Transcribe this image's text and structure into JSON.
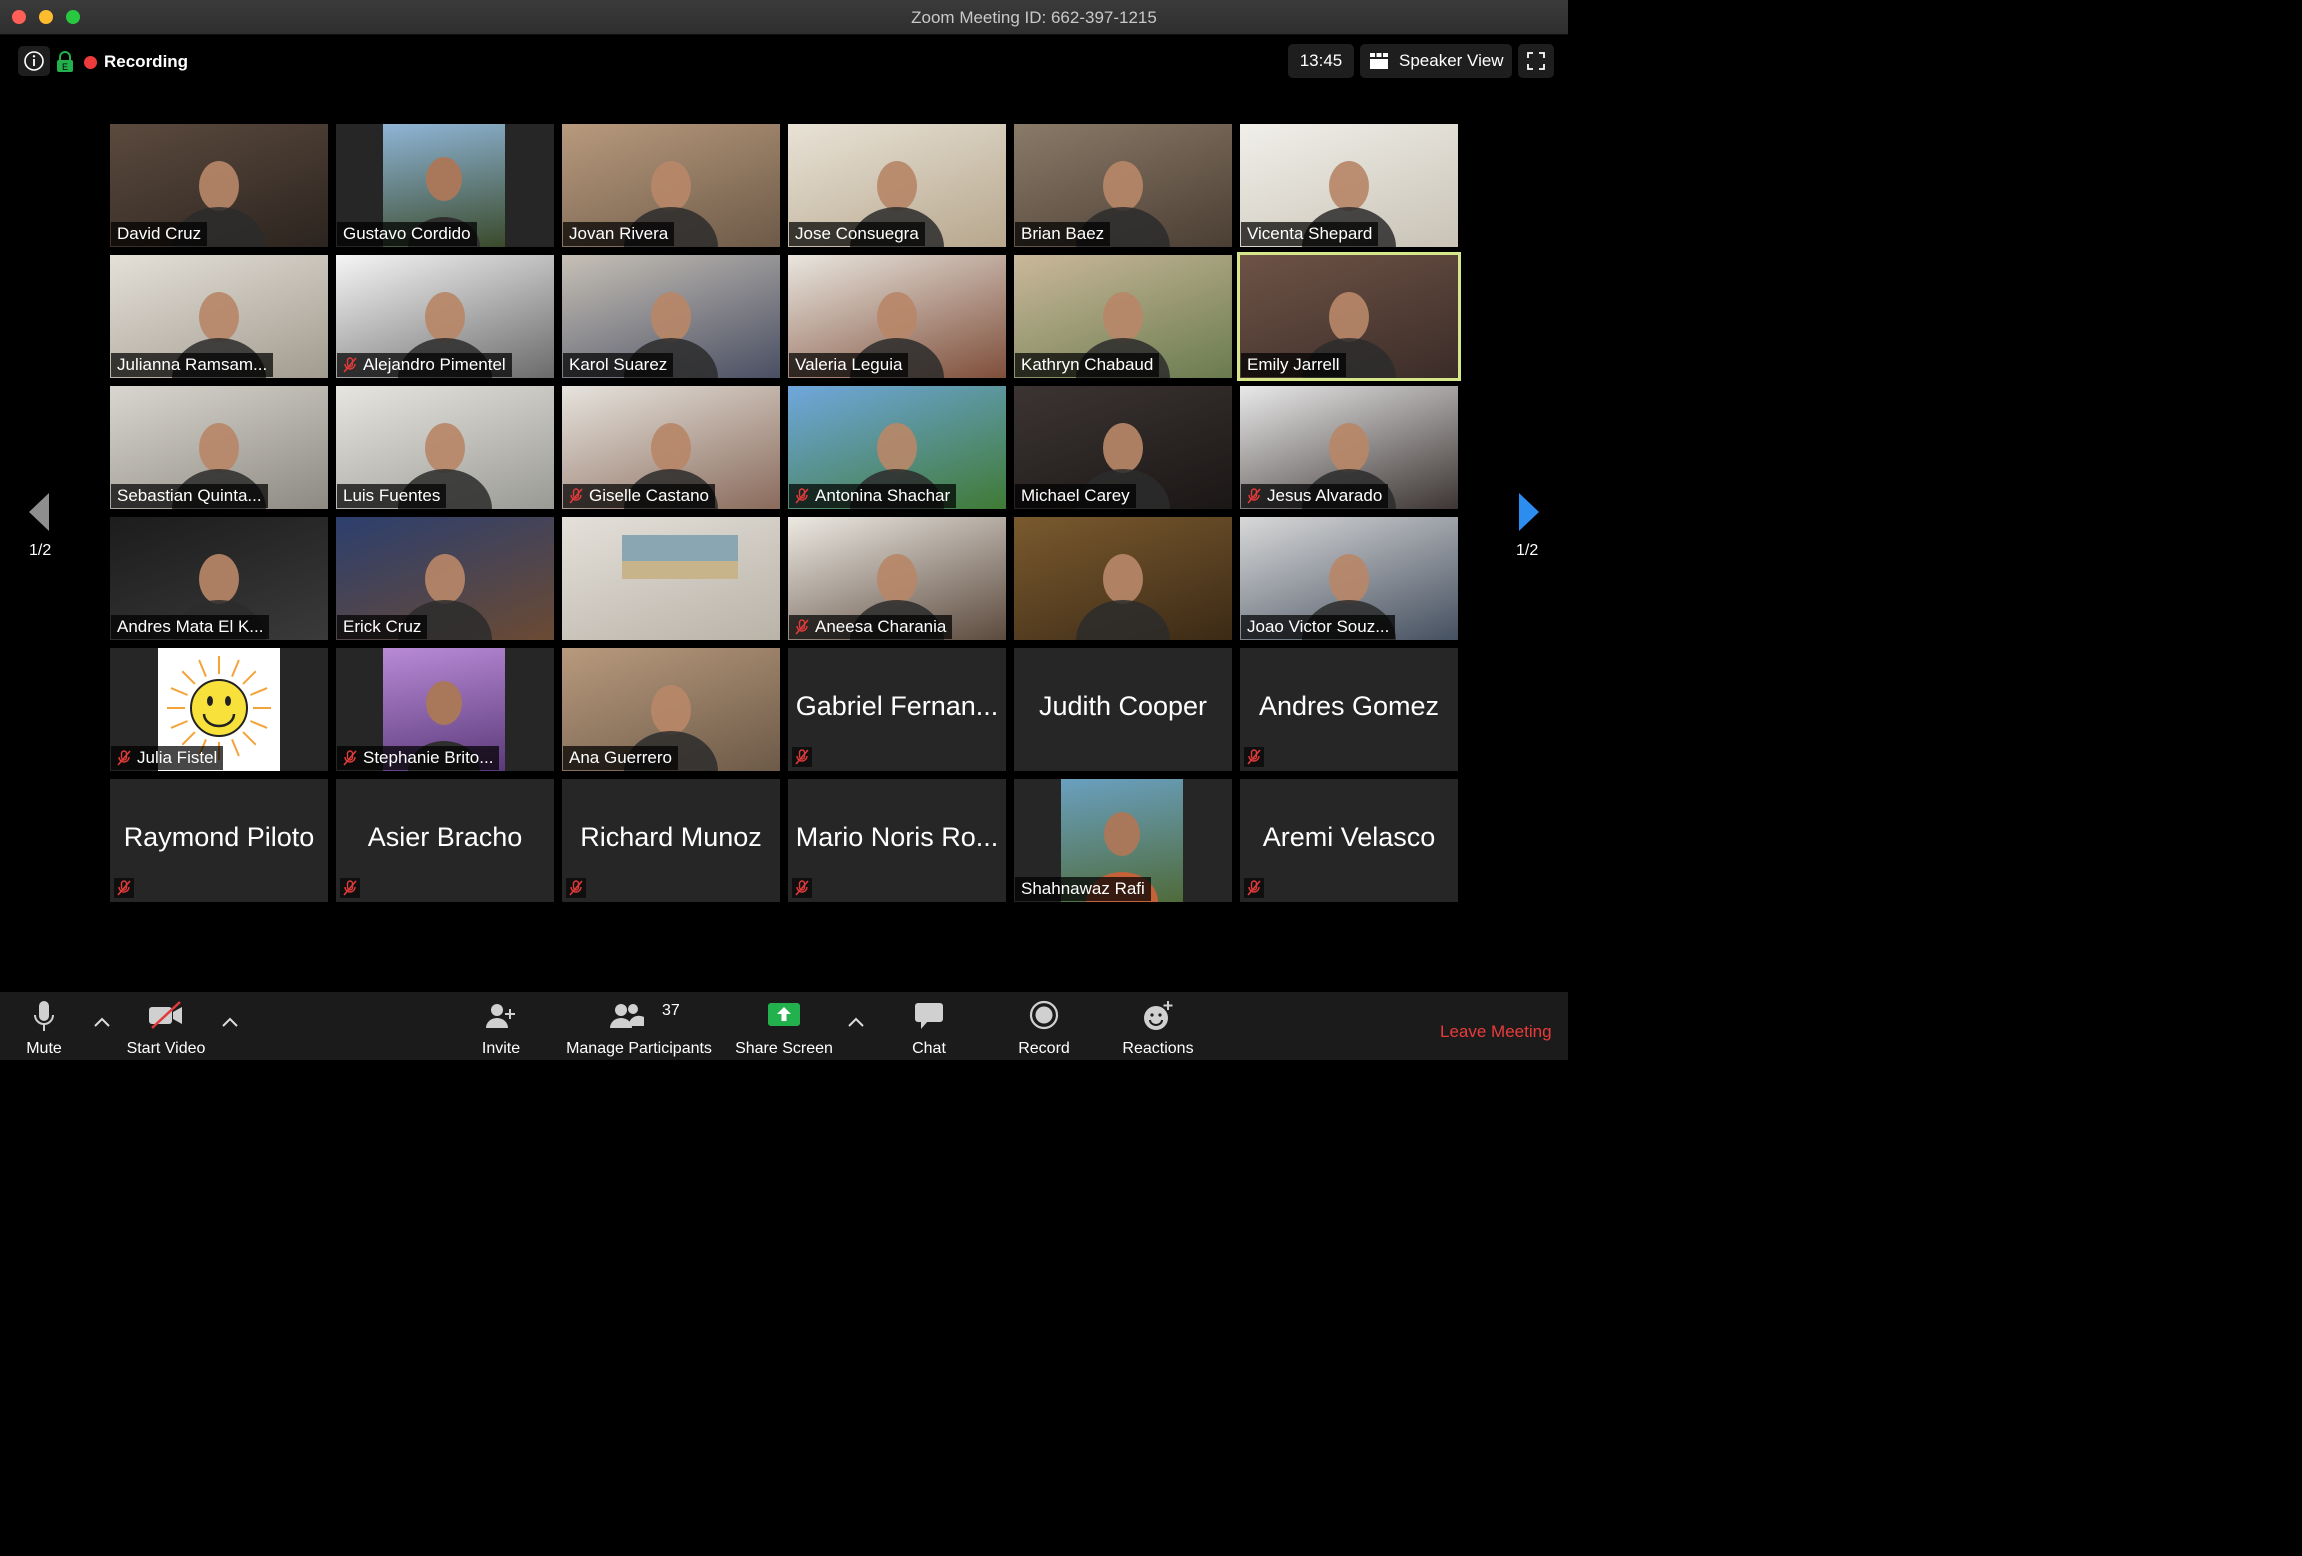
{
  "window": {
    "title": "Zoom Meeting ID: 662-397-1215"
  },
  "topbar": {
    "recording_label": "Recording",
    "time": "13:45",
    "speaker_view_label": "Speaker View"
  },
  "pagination": {
    "left": "1/2",
    "right": "1/2"
  },
  "participants": [
    {
      "name": "David Cruz",
      "muted": false,
      "video": true
    },
    {
      "name": "Gustavo Cordido",
      "muted": false,
      "video": true
    },
    {
      "name": "Jovan Rivera",
      "muted": false,
      "video": true
    },
    {
      "name": "Jose Consuegra",
      "muted": false,
      "video": true
    },
    {
      "name": "Brian Baez",
      "muted": false,
      "video": true
    },
    {
      "name": "Vicenta Shepard",
      "muted": false,
      "video": true
    },
    {
      "name": "Julianna Ramsam...",
      "muted": false,
      "video": true
    },
    {
      "name": "Alejandro Pimentel",
      "muted": true,
      "video": true
    },
    {
      "name": "Karol Suarez",
      "muted": false,
      "video": true
    },
    {
      "name": "Valeria Leguia",
      "muted": false,
      "video": true
    },
    {
      "name": "Kathryn Chabaud",
      "muted": false,
      "video": true
    },
    {
      "name": "Emily Jarrell",
      "muted": false,
      "video": true,
      "active_speaker": true
    },
    {
      "name": "Sebastian Quinta...",
      "muted": false,
      "video": true
    },
    {
      "name": "Luis Fuentes",
      "muted": false,
      "video": true
    },
    {
      "name": "Giselle Castano",
      "muted": true,
      "video": true
    },
    {
      "name": "Antonina Shachar",
      "muted": true,
      "video": true
    },
    {
      "name": "Michael Carey",
      "muted": false,
      "video": true
    },
    {
      "name": "Jesus Alvarado",
      "muted": true,
      "video": true
    },
    {
      "name": "Andres Mata El K...",
      "muted": false,
      "video": true
    },
    {
      "name": "Erick Cruz",
      "muted": false,
      "video": true
    },
    {
      "name": "",
      "muted": false,
      "video": true
    },
    {
      "name": "Aneesa Charania",
      "muted": true,
      "video": true
    },
    {
      "name": "",
      "muted": false,
      "video": true
    },
    {
      "name": "Joao Victor Souz...",
      "muted": false,
      "video": true
    },
    {
      "name": "Julia Fistel",
      "muted": true,
      "video": true
    },
    {
      "name": "Stephanie Brito...",
      "muted": true,
      "video": true
    },
    {
      "name": "Ana Guerrero",
      "muted": false,
      "video": true
    },
    {
      "name": "Gabriel Fernan...",
      "muted": true,
      "video": false
    },
    {
      "name": "Judith Cooper",
      "muted": false,
      "video": false
    },
    {
      "name": "Andres Gomez",
      "muted": true,
      "video": false
    },
    {
      "name": "Raymond Piloto",
      "muted": true,
      "video": false
    },
    {
      "name": "Asier Bracho",
      "muted": true,
      "video": false
    },
    {
      "name": "Richard Munoz",
      "muted": true,
      "video": false
    },
    {
      "name": "Mario Noris Ro...",
      "muted": true,
      "video": false
    },
    {
      "name": "Shahnawaz Rafi",
      "muted": false,
      "video": true
    },
    {
      "name": "Aremi Velasco",
      "muted": true,
      "video": false
    }
  ],
  "toolbar": {
    "mute_label": "Mute",
    "start_video_label": "Start Video",
    "invite_label": "Invite",
    "participants_label": "Manage Participants",
    "participants_count": "37",
    "share_label": "Share Screen",
    "chat_label": "Chat",
    "record_label": "Record",
    "reactions_label": "Reactions",
    "leave_label": "Leave Meeting"
  },
  "colors": {
    "active_speaker_border": "#d6e78a",
    "recording_dot": "#ed3b3b",
    "share_green": "#23b14d",
    "leave_red": "#ea3b3b",
    "nav_arrow_blue": "#2d8cf0"
  }
}
